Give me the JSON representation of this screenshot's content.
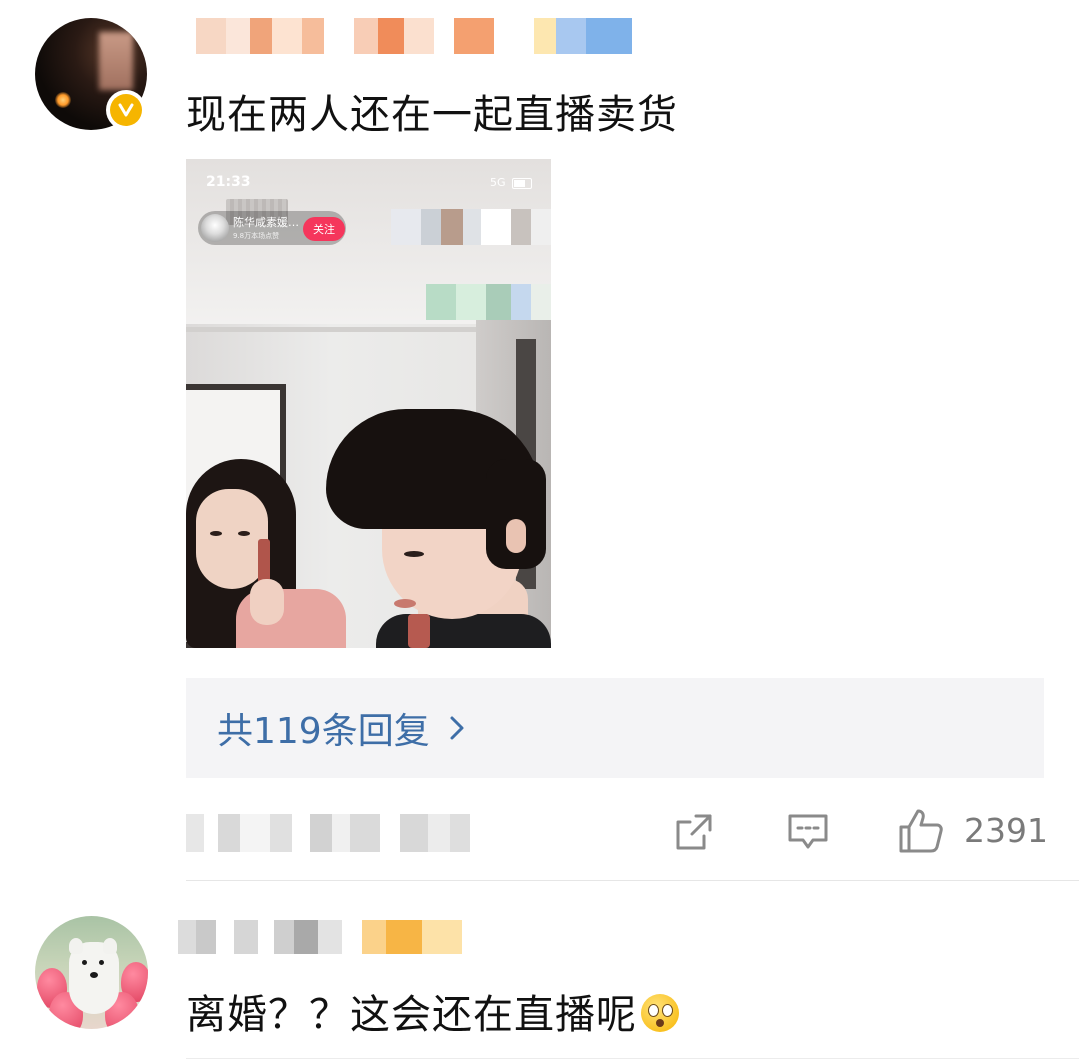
{
  "comment1": {
    "text": "现在两人还在一起直播卖货",
    "screenshot": {
      "time": "21:33",
      "network": "5G",
      "streamer_name": "陈华咸素媛…",
      "stream_sub": "9.8万本场点赞",
      "follow_label": "关注"
    },
    "replies_label": "共119条回复",
    "likes": "2391"
  },
  "comment2": {
    "text": "离婚？？这会还在直播呢"
  },
  "colors": {
    "link": "#3e6ea7",
    "verified_badge": "#f6b500",
    "reply_box_bg": "#f4f4f6",
    "icon_gray": "#8a8a8a"
  },
  "icons": {
    "verified": "verified-v-icon",
    "share": "share-icon",
    "comment": "comment-icon",
    "like": "thumbs-up-icon",
    "chevron": "chevron-right-icon"
  }
}
